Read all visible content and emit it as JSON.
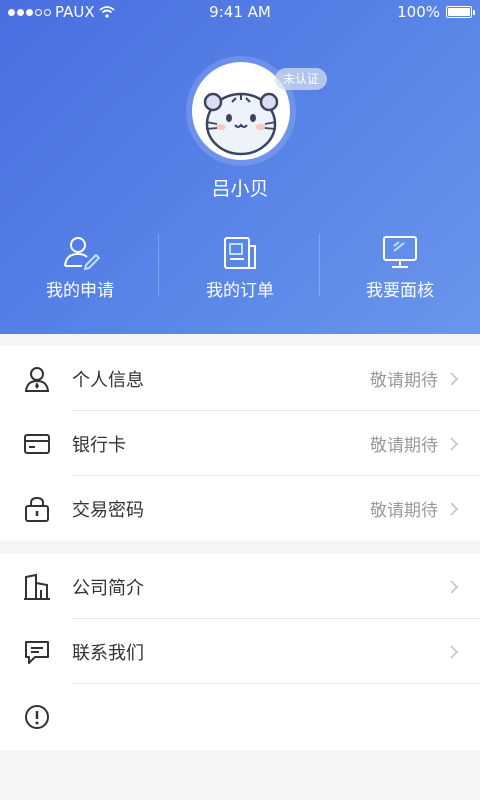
{
  "status": {
    "carrier": "PAUX",
    "time": "9:41 AM",
    "battery": "100%"
  },
  "profile": {
    "name": "吕小贝",
    "badge": "未认证"
  },
  "actions": [
    {
      "label": "我的申请",
      "icon": "user-edit-icon"
    },
    {
      "label": "我的订单",
      "icon": "order-document-icon"
    },
    {
      "label": "我要面核",
      "icon": "monitor-icon"
    }
  ],
  "section1": [
    {
      "label": "个人信息",
      "value": "敬请期待",
      "icon": "person-icon"
    },
    {
      "label": "银行卡",
      "value": "敬请期待",
      "icon": "card-icon"
    },
    {
      "label": "交易密码",
      "value": "敬请期待",
      "icon": "lock-icon"
    }
  ],
  "section2": [
    {
      "label": "公司简介",
      "value": "",
      "icon": "building-icon"
    },
    {
      "label": "联系我们",
      "value": "",
      "icon": "chat-icon"
    },
    {
      "label": "",
      "value": "",
      "icon": "info-icon"
    }
  ],
  "colors": {
    "header": "#4a6ee0",
    "text": "#333333",
    "muted": "#999999"
  }
}
